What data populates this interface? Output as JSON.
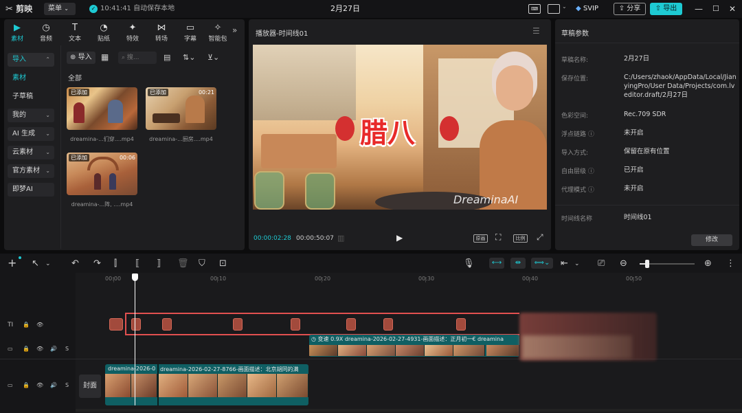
{
  "app": {
    "logo_text": "剪映",
    "menu_label": "菜单",
    "save_status": "10:41:41 自动保存本地",
    "project_title": "2月27日",
    "svip_label": "SVIP",
    "share_label": "分享",
    "export_label": "导出"
  },
  "media_tabs": [
    {
      "label": "素材",
      "icon": "play-square-icon"
    },
    {
      "label": "音频",
      "icon": "music-icon"
    },
    {
      "label": "文本",
      "icon": "text-icon"
    },
    {
      "label": "贴纸",
      "icon": "sticker-icon"
    },
    {
      "label": "特效",
      "icon": "effects-icon"
    },
    {
      "label": "转场",
      "icon": "transition-icon"
    },
    {
      "label": "字幕",
      "icon": "subtitle-icon"
    },
    {
      "label": "智能包",
      "icon": "smart-pack-icon"
    }
  ],
  "sidebar": {
    "items": [
      {
        "label": "导入",
        "arrow": "⌃"
      },
      {
        "label": "素材",
        "arrow": ""
      },
      {
        "label": "子草稿",
        "arrow": ""
      },
      {
        "label": "我的",
        "arrow": "⌄"
      },
      {
        "label": "AI 生成",
        "arrow": "⌄"
      },
      {
        "label": "云素材",
        "arrow": "⌄"
      },
      {
        "label": "官方素材",
        "arrow": "⌄"
      },
      {
        "label": "即梦AI",
        "arrow": ""
      }
    ]
  },
  "media": {
    "import_label": "导入",
    "search_placeholder": "搜...",
    "section_label": "全部",
    "items": [
      {
        "badge": "已添加",
        "duration": "",
        "name": "dreamina-...们穿....mp4"
      },
      {
        "badge": "已添加",
        "duration": "00:21",
        "name": "dreamina-...厨房....mp4"
      },
      {
        "badge": "已添加",
        "duration": "00:06",
        "name": "dreamina-...阵, ....mp4"
      }
    ]
  },
  "player": {
    "title": "播放器-时间线01",
    "current_time": "00:00:02:28",
    "total_time": "00:00:50:07",
    "overlay_text": "腊八",
    "watermark": "DreaminaAI",
    "btn_original": "原画",
    "btn_ratio": "比例"
  },
  "draft": {
    "title": "草稿参数",
    "props": [
      {
        "label": "草稿名称:",
        "value": "2月27日"
      },
      {
        "label": "保存位置:",
        "value": "C:/Users/zhaok/AppData/Local/JianyingPro/User Data/Projects/com.lveditor.draft/2月27日"
      },
      {
        "label": "色彩空间:",
        "value": "Rec.709 SDR"
      },
      {
        "label": "浮点链路 ⓘ",
        "value": "未开启"
      },
      {
        "label": "导入方式:",
        "value": "保留在原有位置"
      },
      {
        "label": "自由层级 ⓘ",
        "value": "已开启"
      },
      {
        "label": "代理模式 ⓘ",
        "value": "未开启"
      },
      {
        "label": "时间线名称",
        "value": "时间线01"
      }
    ],
    "modify_label": "修改"
  },
  "timeline": {
    "ruler": [
      "00:00",
      "00:10",
      "00:20",
      "00:30",
      "00:40",
      "00:50"
    ],
    "cover_label": "封面",
    "track_sticker_label": "TI",
    "speed_clip_label": "变速 0.9X",
    "clip_upper_name": "dreamina-2026-02-27-4931-画面描述：正月初一€",
    "clip_upper_name2": "dreamina",
    "clip_main_a": "dreamina-2026-0",
    "clip_main_b": "dreamina-2026-02-27-8766-画面描述：北京胡同的满"
  },
  "colors": {
    "accent": "#1ecad3",
    "playhead": "#ffffff",
    "selection_box": "#e25050",
    "sticker": "#a24a3c",
    "clip_teal": "#0f5f63"
  }
}
